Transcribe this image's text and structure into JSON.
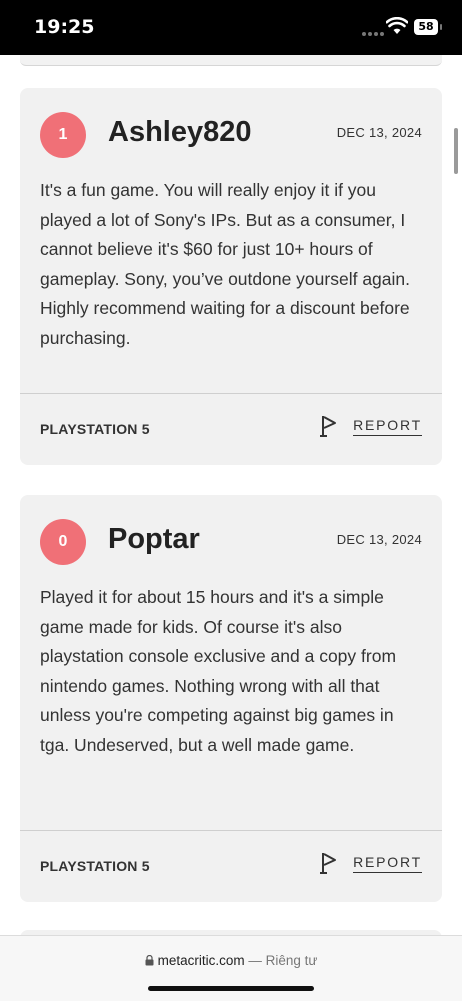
{
  "status_bar": {
    "time": "19:25",
    "battery": "58"
  },
  "reviews": [
    {
      "score": "1",
      "username": "Ashley820",
      "date": "DEC 13, 2024",
      "body": "It's a fun game. You will really enjoy it if you played a lot of Sony's IPs. But as a consumer, I cannot believe it's $60 for just 10+ hours of gameplay. Sony, you’ve outdone yourself again. Highly recommend waiting for a discount before purchasing.",
      "platform": "PLAYSTATION 5",
      "report_label": "REPORT"
    },
    {
      "score": "0",
      "username": "Poptar",
      "date": "DEC 13, 2024",
      "body": "Played it for about 15 hours and it's a simple game made for kids. Of course it's also playstation console exclusive and a copy from nintendo games. Nothing wrong with all that unless you're competing against big games in tga. Undeserved, but a well made game.",
      "platform": "PLAYSTATION 5",
      "report_label": "REPORT"
    }
  ],
  "browser": {
    "url": "metacritic.com",
    "separator": " — ",
    "privacy_label": "Riêng tư"
  },
  "colors": {
    "score_red": "#f07077",
    "card_bg": "#f1f1f1"
  }
}
